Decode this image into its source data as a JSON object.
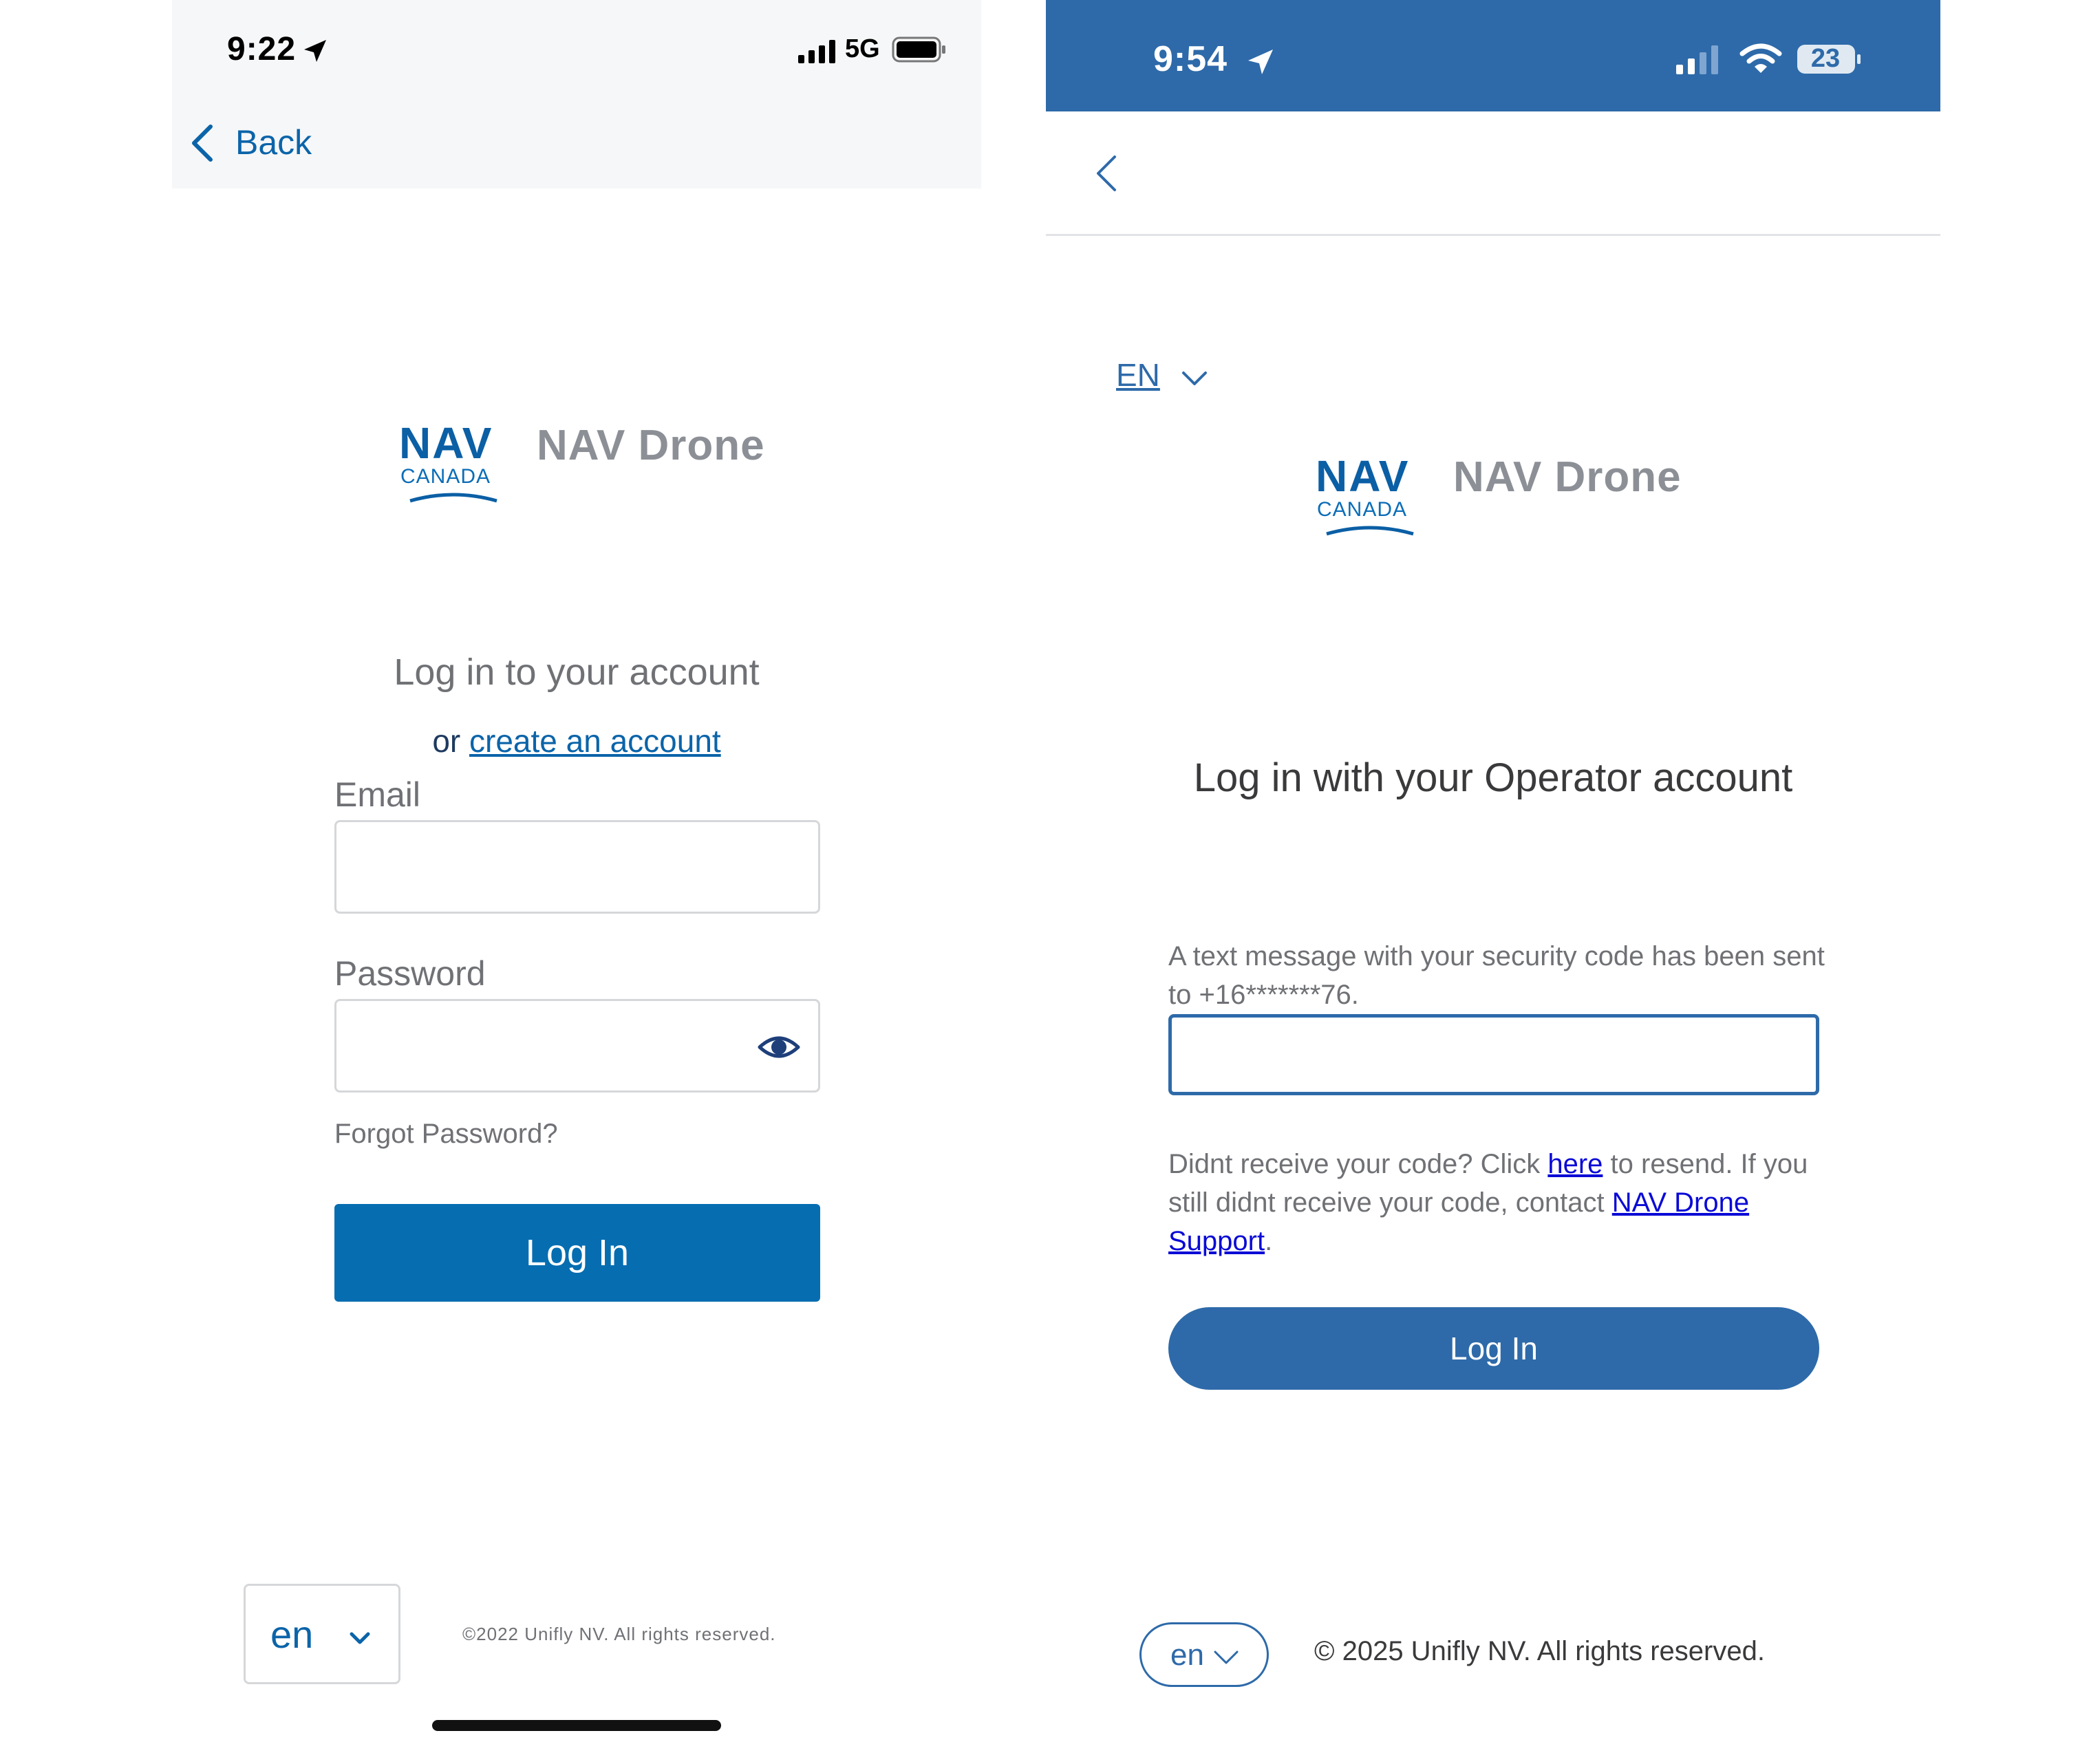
{
  "left": {
    "status": {
      "time": "9:22",
      "network": "5G"
    },
    "nav": {
      "back_label": "Back"
    },
    "logo": {
      "nav_text": "NAV",
      "canada_text": "CANADA",
      "brand": "NAV Drone"
    },
    "heading": "Log in to your account",
    "or_text": "or",
    "create_link": "create an account",
    "email_label": "Email",
    "email_value": "",
    "password_label": "Password",
    "password_value": "",
    "forgot_password": "Forgot Password?",
    "login_button": "Log In",
    "language": "en",
    "copyright": "©2022 Unifly NV. All rights reserved."
  },
  "right": {
    "status": {
      "time": "9:54",
      "battery": "23"
    },
    "language_top": "EN",
    "logo": {
      "nav_text": "NAV",
      "canada_text": "CANADA",
      "brand": "NAV Drone"
    },
    "heading": "Log in with your Operator account",
    "message": "A text message with your security code has been sent to +16*******76.",
    "code_value": "",
    "resend": {
      "prefix": "Didnt receive your code? Click ",
      "here_link": "here",
      "middle": " to resend. If you still didnt receive your code, contact ",
      "support_link": "NAV Drone Support",
      "suffix": "."
    },
    "login_button": "Log In",
    "language": "en",
    "copyright": "© 2025 Unifly NV. All rights reserved."
  },
  "colors": {
    "left_primary": "#066db1",
    "right_primary": "#2e6aa9",
    "link_blue": "#0a0ad6",
    "brand_gray": "#8c9096"
  }
}
